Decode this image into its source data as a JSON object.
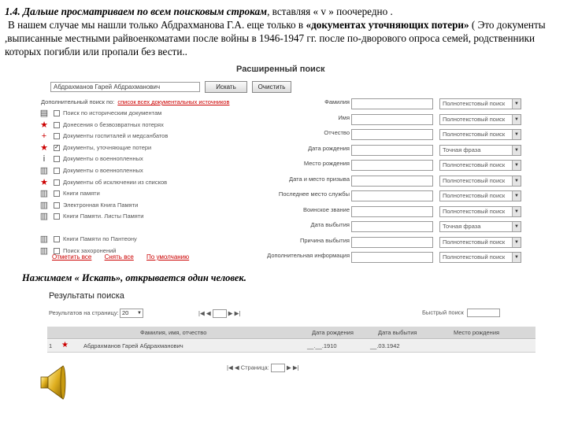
{
  "intro": {
    "heading": "1.4. Дальше просматриваем по всем поисковым строкам",
    "heading_tail": ", вставляя « v » поочередно .",
    "body_1": "В нашем случае мы нашли только Абдрахманова Г.А. еще только в ",
    "body_bold": "«документах уточняющих потери»",
    "body_2": " ( Это документы ,выписанные местными райвоенкоматами после войны в 1946-1947 гг. после по-дворового опроса семей, родственники которых погибли или пропали без вести.."
  },
  "search_form": {
    "title": "Расширенный поиск",
    "name_input_value": "Абдрахманов Гарей Абдрахманович",
    "search_button": "Искать",
    "reset_button": "Очистить",
    "sources_header": "Дополнительный поиск по:",
    "sources_header_link": "список всех документальных источников",
    "sources": [
      {
        "icon": "document-icon",
        "icon_glyph": "▤",
        "checked": false,
        "label": "Поиск по историческим документам"
      },
      {
        "icon": "star-icon",
        "icon_glyph": "★",
        "checked": false,
        "label": "Донесения о безвозвратных потерях"
      },
      {
        "icon": "cross-icon",
        "icon_glyph": "+",
        "checked": false,
        "label": "Документы госпиталей и медсанбатов"
      },
      {
        "icon": "star-icon",
        "icon_glyph": "★",
        "checked": true,
        "label": "Документы, уточняющие потери"
      },
      {
        "icon": "info-icon",
        "icon_glyph": "i",
        "checked": false,
        "label": "Документы о военнопленных"
      },
      {
        "icon": "book-icon",
        "icon_glyph": "▥",
        "checked": false,
        "label": "Документы о военнопленных"
      },
      {
        "icon": "star-icon",
        "icon_glyph": "★",
        "checked": false,
        "label": "Документы об исключении из списков"
      },
      {
        "icon": "book-icon",
        "icon_glyph": "▥",
        "checked": false,
        "label": "Книги памяти"
      },
      {
        "icon": "book-icon",
        "icon_glyph": "▥",
        "checked": false,
        "label": "Электронная Книга Памяти"
      },
      {
        "icon": "book-icon",
        "icon_glyph": "▥",
        "checked": false,
        "label": "Книги Памяти. Листы Памяти"
      },
      {
        "icon": "book-icon",
        "icon_glyph": "▥",
        "checked": false,
        "label": "Книги Памяти по Пантеону"
      },
      {
        "icon": "grave-icon",
        "icon_glyph": "▥",
        "checked": false,
        "label": "Поиск захоронений"
      }
    ],
    "select_all": "Отметить все",
    "deselect_all": "Снять все",
    "default": "По умолчанию",
    "fields": [
      {
        "label": "Фамилия",
        "mode": "Полнотекстовый поиск"
      },
      {
        "label": "Имя",
        "mode": "Полнотекстовый поиск"
      },
      {
        "label": "Отчество",
        "mode": "Полнотекстовый поиск"
      },
      {
        "label": "Дата рождения",
        "mode": "Точная фраза"
      },
      {
        "label": "Место рождения",
        "mode": "Полнотекстовый поиск"
      },
      {
        "label": "Дата и место призыва",
        "mode": "Полнотекстовый поиск"
      },
      {
        "label": "Последнее место службы",
        "mode": "Полнотекстовый поиск"
      },
      {
        "label": "Воинское звание",
        "mode": "Полнотекстовый поиск"
      },
      {
        "label": "Дата выбытия",
        "mode": "Точная фраза"
      },
      {
        "label": "Причина выбытия",
        "mode": "Полнотекстовый поиск"
      },
      {
        "label": "Дополнительная информация",
        "mode": "Полнотекстовый поиск"
      }
    ]
  },
  "caption": "Нажимаем « Искать», открывается один человек.",
  "results": {
    "title": "Результаты поиска",
    "per_page_label": "Результатов на страницу:",
    "per_page_value": "20",
    "pager_text": "Страница:",
    "adv_search_label": "Быстрый поиск",
    "headers": [
      "Фамилия, имя, отчество",
      "Дата рождения",
      "Дата выбытия",
      "Место рождения"
    ],
    "rows": [
      {
        "num": "1",
        "name": "Абдрахманов Гарей Абдрахманович",
        "birth": "__.__.1910",
        "out": "__.03.1942",
        "place": ""
      }
    ]
  }
}
